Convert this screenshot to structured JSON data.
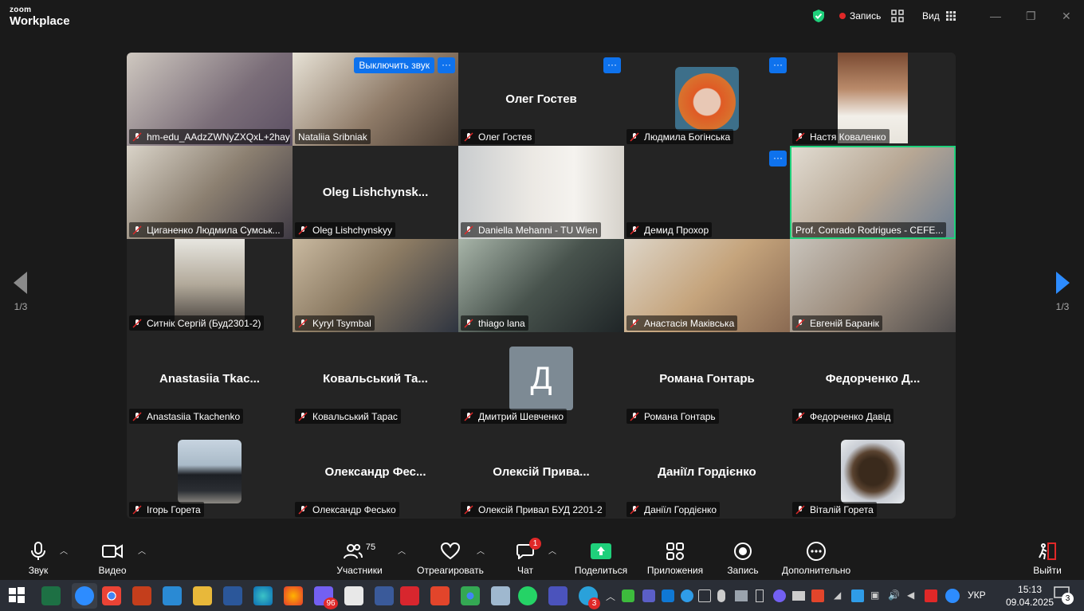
{
  "app": {
    "brand_top": "zoom",
    "brand_bottom": "Workplace"
  },
  "titlebar": {
    "record_label": "Запись",
    "view_label": "Вид"
  },
  "pager": {
    "left": "1/3",
    "right": "1/3"
  },
  "tile_controls": {
    "mute_label": "Выключить звук",
    "more_label": "···"
  },
  "tiles": [
    {
      "name": "hm-edu_AAdzZWNyZXQxL+2hayf...",
      "video": true
    },
    {
      "name": "Nataliia Sribniak",
      "video": true
    },
    {
      "name": "Олег Гостев",
      "bigname": "Олег Гостев"
    },
    {
      "name": "Людмила Богінська",
      "photo": true
    },
    {
      "name": "Настя Коваленко",
      "photo": true
    },
    {
      "name": "Циганенко Людмила Сумськ...",
      "video": true
    },
    {
      "name": "Oleg Lishchynskyy",
      "bigname": "Oleg  Lishchynsk..."
    },
    {
      "name": "Daniella Mehanni - TU Wien",
      "video": true
    },
    {
      "name": "Демид Прохор"
    },
    {
      "name": "Prof. Conrado Rodrigues - CEFE...",
      "video": true
    },
    {
      "name": "Ситнік Сергій (Буд2301-2)",
      "photo": true
    },
    {
      "name": "Kyryl Tsymbal",
      "video": true
    },
    {
      "name": "thiago lana",
      "video": true
    },
    {
      "name": "Анастасія Маківська",
      "video": true
    },
    {
      "name": "Евгеній Баранік",
      "video": true
    },
    {
      "name": "Anastasiia Tkachenko",
      "bigname": "Anastasiia  Tkac..."
    },
    {
      "name": "Ковальський Тарас",
      "bigname": "Ковальський  Та..."
    },
    {
      "name": "Дмитрий Шевченко",
      "letter": "Д"
    },
    {
      "name": "Романа Гонтарь",
      "bigname": "Романа Гонтарь"
    },
    {
      "name": "Федорченко Давід",
      "bigname": "Федорченко  Д..."
    },
    {
      "name": "Ігорь Горета",
      "photo": true
    },
    {
      "name": "Олександр Фесько",
      "bigname": "Олександр  Фес..."
    },
    {
      "name": "Олексій Привал БУД 2201-2",
      "bigname": "Олексій  Прива..."
    },
    {
      "name": "Даніїл Гордієнко",
      "bigname": "Даніїл Гордієнко"
    },
    {
      "name": "Віталій Горета",
      "photo": true
    }
  ],
  "toolbar": {
    "audio": "Звук",
    "video": "Видео",
    "participants": "Участники",
    "participants_count": "75",
    "react": "Отреагировать",
    "chat": "Чат",
    "chat_badge": "1",
    "share": "Поделиться",
    "apps": "Приложения",
    "record": "Запись",
    "more": "Дополнительно",
    "leave": "Выйти"
  },
  "taskbar": {
    "lang": "УКР",
    "time": "15:13",
    "date": "09.04.2025",
    "notif_count": "3",
    "viber_badge": "96",
    "telegram_badge": "3"
  },
  "colors": {
    "accent": "#0e72ed",
    "active_speaker": "#1fd07b",
    "record_dot": "#e02828"
  }
}
